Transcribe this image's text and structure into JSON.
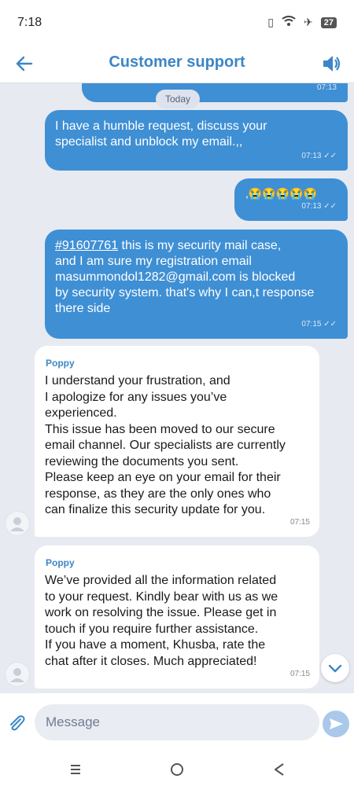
{
  "status_bar": {
    "time": "7:18",
    "battery": "27"
  },
  "header": {
    "title": "Customer support"
  },
  "chat": {
    "date_chip": "Today",
    "messages": [
      {
        "direction": "out",
        "text": "",
        "time": "07:13"
      },
      {
        "direction": "out",
        "text": "I have a humble request, discuss your\nspecialist and unblock my email.,,",
        "time": "07:13"
      },
      {
        "direction": "out",
        "text": ",😭😭😭😭😭",
        "time": "07:13"
      },
      {
        "direction": "out",
        "case_link": "#91607761",
        "text": " this is my security mail case,\nand I am sure my registration email\nmasummondol1282@gmail.com is blocked\nby security system. that's why I can,t response\nthere side",
        "time": "07:15"
      },
      {
        "direction": "in",
        "sender": "Poppy",
        "text": "I understand your frustration, and\nI apologize for any issues you’ve\nexperienced.\nThis issue has been moved to our secure\nemail channel. Our specialists are currently\nreviewing the documents you sent.\nPlease keep an eye on your email for their\nresponse, as they are the only ones who\ncan finalize this security update for you.",
        "time": "07:15"
      },
      {
        "direction": "in",
        "sender": "Poppy",
        "text": "We’ve provided all the information related\nto your request. Kindly bear with us as we\nwork on resolving the issue. Please get in\ntouch if you require further assistance.\nIf you have a moment, Khusba, rate the\nchat after it closes. Much appreciated!",
        "time": "07:15"
      }
    ]
  },
  "composer": {
    "placeholder": "Message"
  },
  "colors": {
    "accent": "#3d86c6",
    "outgoing_bubble": "#3f8fd4",
    "background": "#e7eaf1"
  },
  "icons": [
    "back-arrow-icon",
    "speaker-icon",
    "double-check-icon",
    "avatar-icon",
    "chevron-down-icon",
    "paperclip-icon",
    "send-icon",
    "recents-icon",
    "home-icon",
    "back-triangle-icon"
  ]
}
